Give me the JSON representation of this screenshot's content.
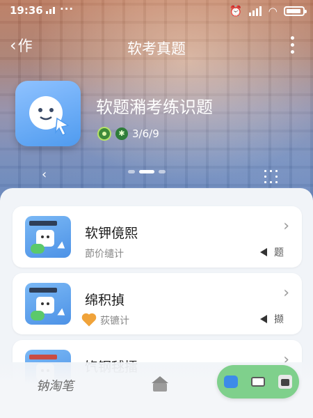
{
  "status_bar": {
    "time": "19:36",
    "overflow": "···"
  },
  "nav": {
    "back_label": "作",
    "title": "软考真题",
    "menu_icon": "more-vertical-icon"
  },
  "app": {
    "name": "软题潲考练识题",
    "rating": "3/6/9",
    "icon": "chat-bot-icon"
  },
  "hero": {
    "pager_total": 3,
    "pager_active": 1
  },
  "items": [
    {
      "name": "软钾傹熙",
      "sub": "莭价缱计",
      "tag": "题",
      "icon": "chat-window-icon"
    },
    {
      "name": "绵积揁",
      "sub": "荻镳计",
      "tag": "撷",
      "icon": "chat-window-icon"
    },
    {
      "name": "饩钢毬擂",
      "sub": "",
      "tag": "",
      "icon": "chat-window-icon"
    }
  ],
  "bottom": {
    "left_label": "钠淘笔"
  },
  "colors": {
    "accent_green": "#7fd08c",
    "brand_blue": "#4f9bef"
  }
}
